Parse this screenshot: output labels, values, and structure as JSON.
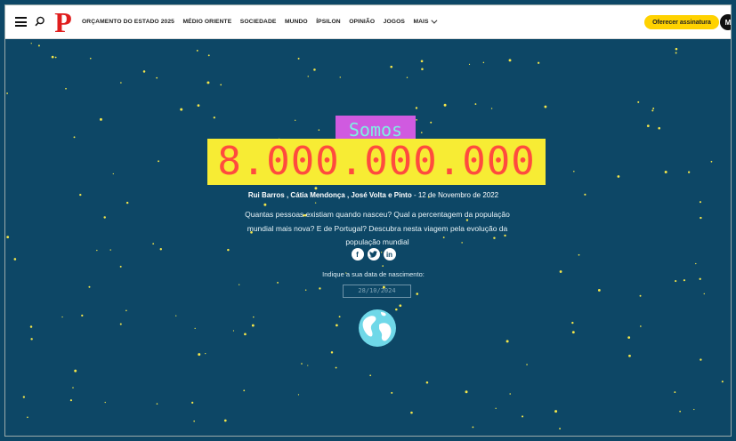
{
  "header": {
    "nav": [
      "ORÇAMENTO DO ESTADO 2025",
      "MÉDIO ORIENTE",
      "SOCIEDADE",
      "MUNDO",
      "ÍPSILON",
      "OPINIÃO",
      "JOGOS",
      "MAIS"
    ],
    "subscribe_label": "Oferecer assinatura",
    "avatar_initial": "M",
    "logo_letter": "P"
  },
  "hero": {
    "somos": "Somos",
    "population": "8.000.000.000",
    "authors": "Rui Barros , Cátia Mendonça , José Volta e Pinto",
    "date": " - 12 de Novembro de 2022",
    "lead": "Quantas pessoas existiam quando nasceu? Qual a percentagem da população mundial mais nova? E de Portugal? Descubra nesta viagem pela evolução da população mundial",
    "dob_label": "Indique a sua data de nascimento:",
    "dob_value": "28/10/2024"
  },
  "social": [
    "facebook-icon",
    "twitter-icon",
    "linkedin-icon"
  ],
  "colors": {
    "background": "#0d4766",
    "somos_bg": "#d05ae0",
    "somos_text": "#7ef0e2",
    "number_bg": "#f7ec34",
    "number_text": "#ff4b3e",
    "subscribe_bg": "#ffd200",
    "star": "#f4e64a"
  }
}
